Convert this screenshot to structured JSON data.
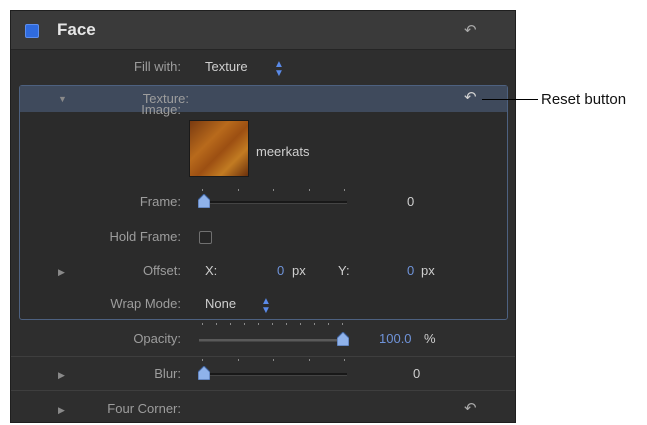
{
  "panel": {
    "title": "Face",
    "fill_with": {
      "label": "Fill with:",
      "value": "Texture"
    },
    "texture": {
      "label": "Texture:",
      "image": {
        "label": "Image:",
        "name": "meerkats"
      },
      "frame": {
        "label": "Frame:",
        "value": "0"
      },
      "hold_frame": {
        "label": "Hold Frame:",
        "checked": false
      },
      "offset": {
        "label": "Offset:",
        "x_label": "X:",
        "x_value": "0",
        "x_unit": "px",
        "y_label": "Y:",
        "y_value": "0",
        "y_unit": "px"
      },
      "wrap_mode": {
        "label": "Wrap Mode:",
        "value": "None"
      }
    },
    "opacity": {
      "label": "Opacity:",
      "value": "100.0",
      "unit": "%"
    },
    "blur": {
      "label": "Blur:",
      "value": "0"
    },
    "four_corner": {
      "label": "Four Corner:"
    }
  },
  "annotation": {
    "text": "Reset button"
  },
  "colors": {
    "accent": "#2f6bdf",
    "value_blue": "#6f93d9",
    "panel_bg": "#2e2e2e"
  }
}
